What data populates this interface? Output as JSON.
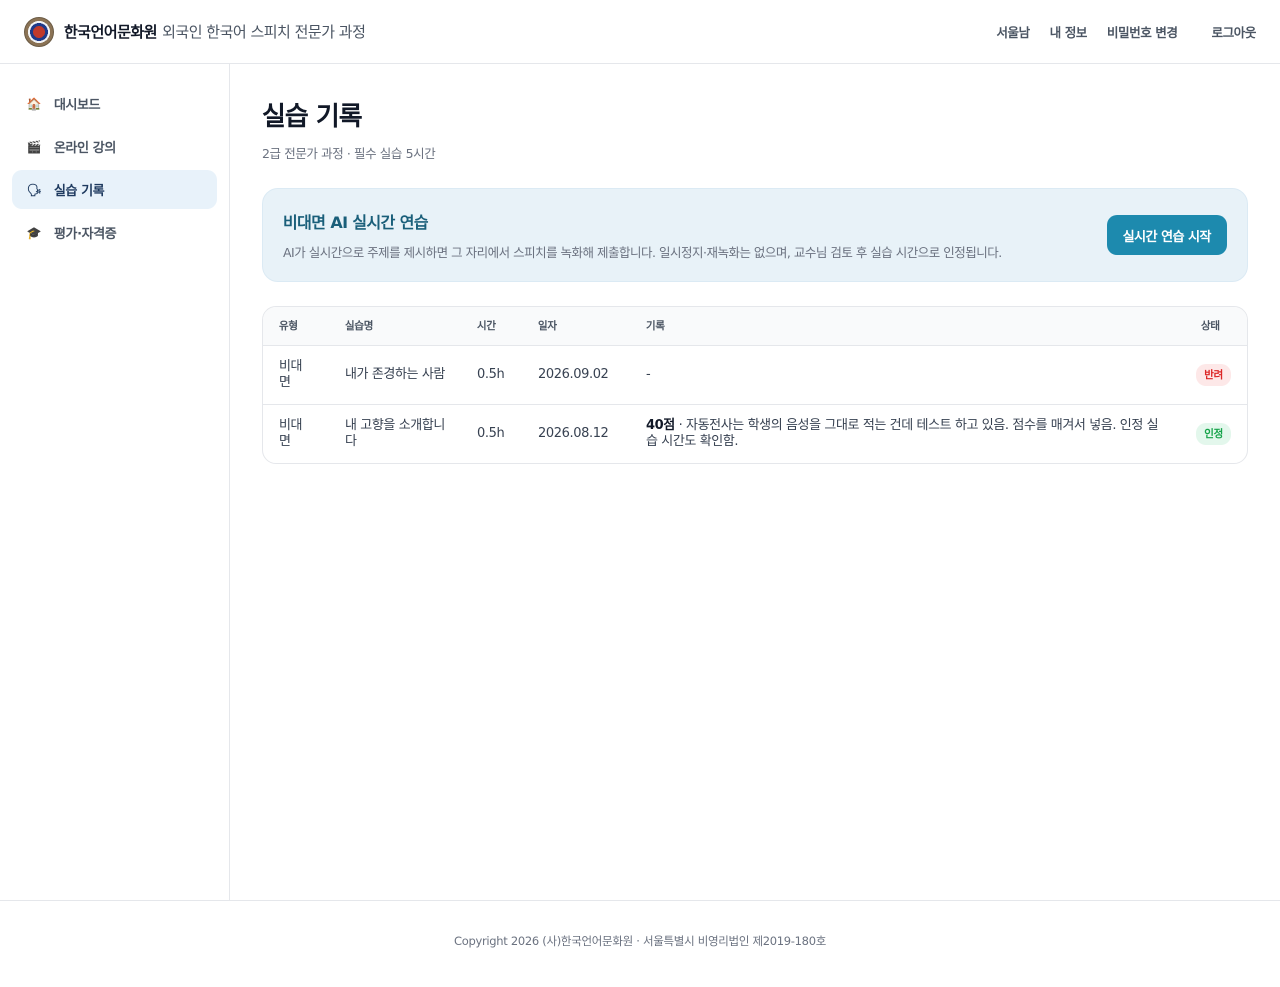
{
  "header": {
    "brand_name": "한국언어문화원",
    "brand_sub": "외국인 한국어 스피치 전문가 과정",
    "nav": {
      "user": "서울남",
      "my_info": "내 정보",
      "change_password": "비밀번호 변경",
      "logout": "로그아웃"
    }
  },
  "sidebar": {
    "items": [
      {
        "icon": "🏠",
        "label": "대시보드",
        "icon_name": "home-icon"
      },
      {
        "icon": "🎬",
        "label": "온라인 강의",
        "icon_name": "clapperboard-icon"
      },
      {
        "icon": "🗣",
        "label": "실습 기록",
        "icon_name": "speaking-head-icon"
      },
      {
        "icon": "🎓",
        "label": "평가·자격증",
        "icon_name": "graduation-cap-icon"
      }
    ],
    "active_index": 2
  },
  "main": {
    "title": "실습 기록",
    "subtitle": "2급 전문가 과정 · 필수 실습 5시간",
    "banner": {
      "title": "비대면 AI 실시간 연습",
      "description": "AI가 실시간으로 주제를 제시하면 그 자리에서 스피치를 녹화해 제출합니다. 일시정지·재녹화는 없으며, 교수님 검토 후 실습 시간으로 인정됩니다.",
      "button_label": "실시간 연습 시작"
    },
    "table": {
      "headers": {
        "type": "유형",
        "name": "실습명",
        "hours": "시간",
        "date": "일자",
        "record": "기록",
        "status": "상태"
      },
      "rows": [
        {
          "type": "비대면",
          "name": "내가 존경하는 사람",
          "hours": "0.5h",
          "date": "2026.09.02",
          "score": "",
          "record": "-",
          "status": "반려"
        },
        {
          "type": "비대면",
          "name": "내 고향을 소개합니다",
          "hours": "0.5h",
          "date": "2026.08.12",
          "score": "40점",
          "record": " · 자동전사는 학생의 음성을 그대로 적는 건데 테스트 하고 있음. 점수를 매겨서 넣음. 인정 실습 시간도 확인함.",
          "status": "인정"
        }
      ]
    }
  },
  "footer": {
    "text": "Copyright 2026 (사)한국언어문화원 · 서울특별시 비영리법인 제2019-180호"
  },
  "colors": {
    "accent": "#1d8aae",
    "banner_bg": "#e8f2f8",
    "active_nav_bg": "#e8f2fa",
    "rejected": "#dc2626",
    "approved": "#16a34a"
  }
}
